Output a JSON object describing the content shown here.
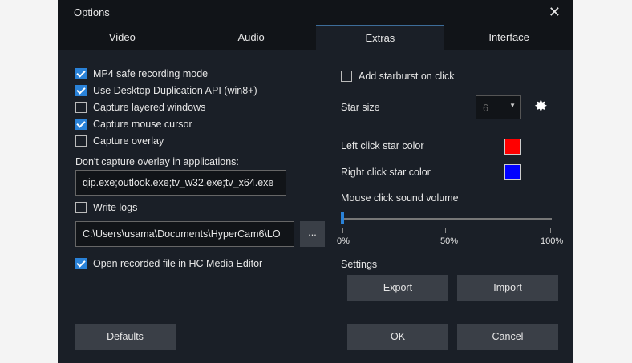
{
  "title": "Options",
  "tabs": [
    "Video",
    "Audio",
    "Extras",
    "Interface"
  ],
  "left": {
    "mp4": {
      "label": "MP4 safe recording mode",
      "checked": true
    },
    "ddapi": {
      "label": "Use Desktop Duplication API (win8+)",
      "checked": true
    },
    "layered": {
      "label": "Capture layered windows",
      "checked": false
    },
    "cursor": {
      "label": "Capture mouse cursor",
      "checked": true
    },
    "overlay": {
      "label": "Capture overlay",
      "checked": false
    },
    "exclude_label": "Don't capture overlay in applications:",
    "exclude_value": "qip.exe;outlook.exe;tv_w32.exe;tv_x64.exe",
    "logs": {
      "label": "Write logs",
      "checked": false
    },
    "log_path": "C:\\Users\\usama\\Documents\\HyperCam6\\LO",
    "browse": "...",
    "open_editor": {
      "label": "Open recorded file in HC Media Editor",
      "checked": true
    }
  },
  "right": {
    "starburst": {
      "label": "Add starburst on click",
      "checked": false
    },
    "star_size_label": "Star size",
    "star_size": "6",
    "left_color_label": "Left click star color",
    "left_color": "#ff0000",
    "right_color_label": "Right click star color",
    "right_color": "#0000ff",
    "volume_label": "Mouse click sound volume",
    "volume": 0,
    "ticks": [
      "0%",
      "50%",
      "100%"
    ],
    "settings_label": "Settings",
    "export": "Export",
    "import": "Import"
  },
  "footer": {
    "defaults": "Defaults",
    "ok": "OK",
    "cancel": "Cancel"
  }
}
